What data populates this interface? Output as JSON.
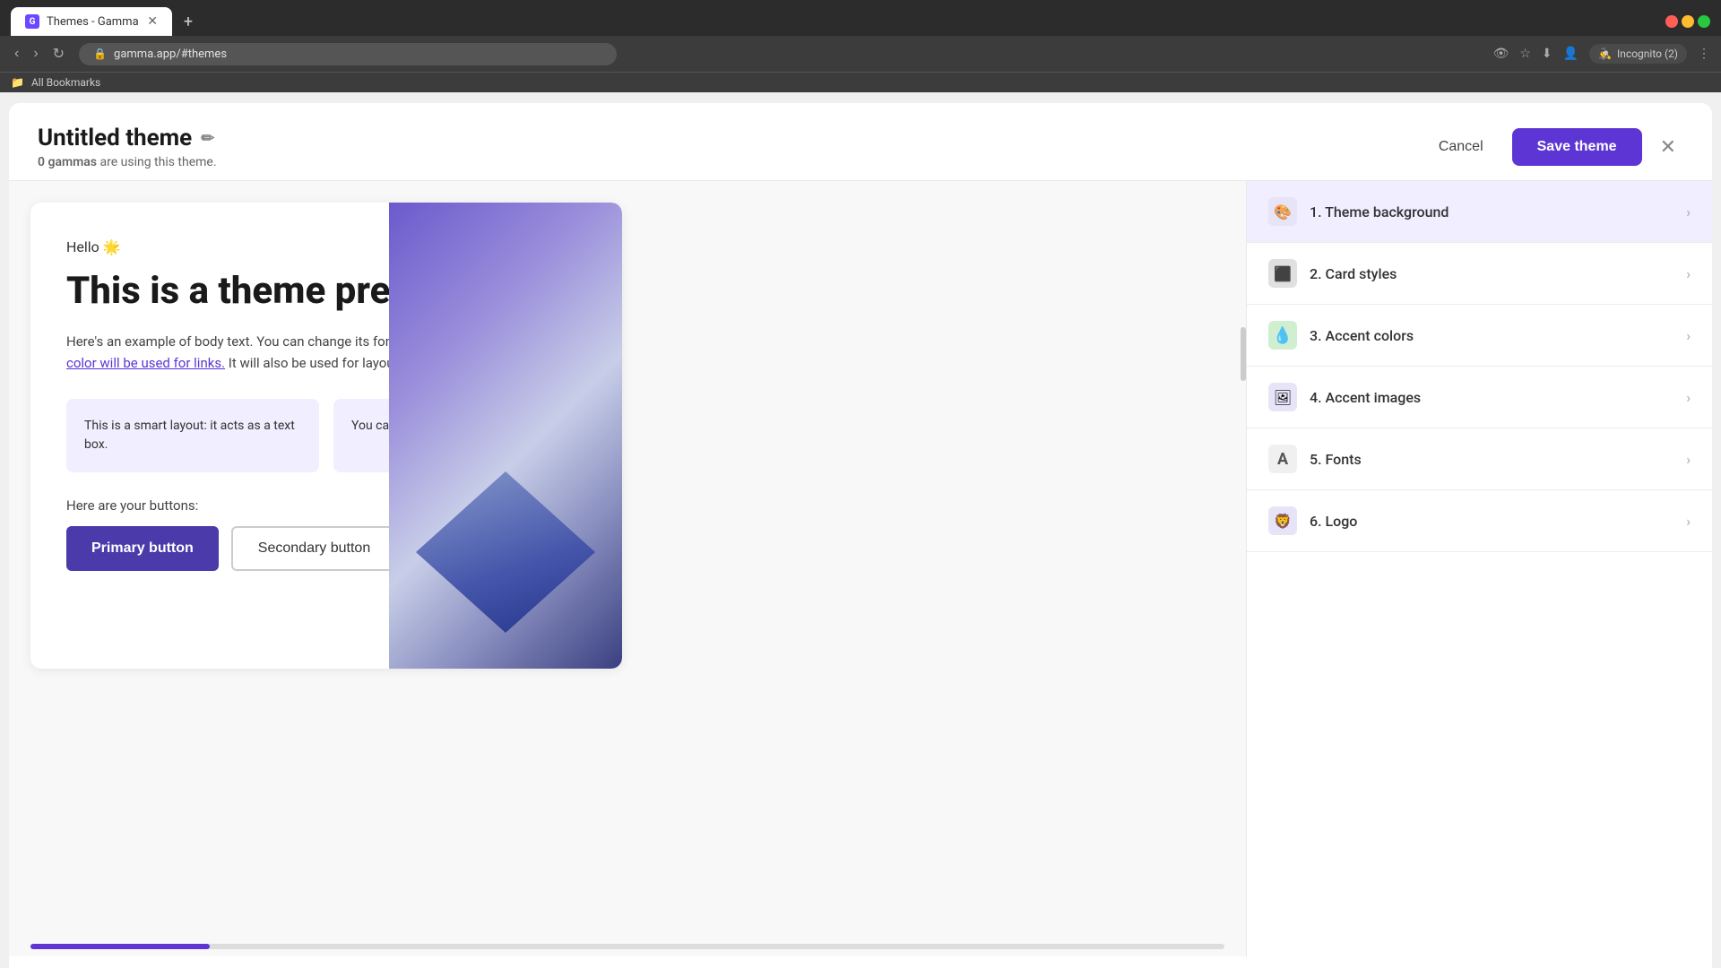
{
  "browser": {
    "tab_title": "Themes - Gamma",
    "url": "gamma.app/#themes",
    "incognito_label": "Incognito (2)",
    "bookmarks_label": "All Bookmarks",
    "new_tab_icon": "+",
    "back_icon": "‹",
    "forward_icon": "›",
    "refresh_icon": "↻",
    "favicon_letter": "G"
  },
  "modal": {
    "title": "Untitled theme",
    "subtitle_count": "0 gammas",
    "subtitle_rest": "are using this theme.",
    "cancel_label": "Cancel",
    "save_label": "Save theme",
    "close_icon": "✕"
  },
  "preview": {
    "hello": "Hello 🌟",
    "headline": "This is a theme preview",
    "body_text": "Here's an example of body text. You can change its font and the color.",
    "link_text": "Your accent color will be used for links.",
    "body_text_after": " It will also be used for layouts and buttons.",
    "card1": "This is a smart layout: it acts as a text box.",
    "card2": "You can get these by typing /smart",
    "buttons_label": "Here are your buttons:",
    "primary_button": "Primary button",
    "secondary_button": "Secondary button"
  },
  "settings": {
    "items": [
      {
        "id": "theme-background",
        "label": "1. Theme background",
        "icon": "🎨",
        "icon_class": "icon-bg",
        "active": true
      },
      {
        "id": "card-styles",
        "label": "2. Card styles",
        "icon": "⬛",
        "icon_class": "icon-card"
      },
      {
        "id": "accent-colors",
        "label": "3. Accent colors",
        "icon": "💧",
        "icon_class": "icon-accent"
      },
      {
        "id": "accent-images",
        "label": "4. Accent images",
        "icon": "🖼",
        "icon_class": "icon-image"
      },
      {
        "id": "fonts",
        "label": "5. Fonts",
        "icon": "A",
        "icon_class": "icon-font"
      },
      {
        "id": "logo",
        "label": "6. Logo",
        "icon": "🦁",
        "icon_class": "icon-logo"
      }
    ]
  },
  "colors": {
    "accent_purple": "#5c35d4",
    "primary_btn_bg": "#4a3aaa",
    "card_bg": "#f0eeff",
    "settings_active_bg": "#f0eeff"
  }
}
